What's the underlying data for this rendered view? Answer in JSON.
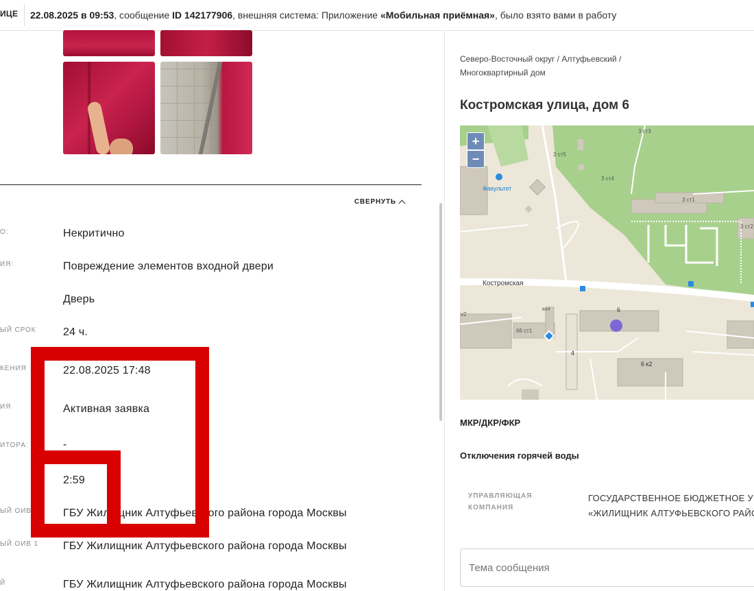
{
  "topbar": {
    "left_label": "ИЦЕ",
    "datetime": "22.08.2025 в 09:53",
    "text1": ", сообщение ",
    "msg_id": "ID 142177906",
    "text2": ", внешняя система: Приложение ",
    "system": "«Мобильная приёмная»",
    "text3": ", было взято вами в работу"
  },
  "details": {
    "collapse_label": "СВЕРНУТЬ",
    "rows": [
      {
        "label": "О:",
        "value": "Некритично"
      },
      {
        "label": "ИЯ:",
        "value": "Повреждение элементов входной двери"
      },
      {
        "label": "",
        "value": "Дверь"
      },
      {
        "label": "ЫЙ СРОК",
        "value": "24 ч."
      },
      {
        "label": "КЕНИЯ",
        "value": "22.08.2025 17:48"
      },
      {
        "label": "ИЯ",
        "value": "Активная заявка"
      },
      {
        "label": "ИТОРА:",
        "value": "-"
      },
      {
        "label": "",
        "value": "2:59"
      },
      {
        "label": "ЫЙ ОИВ",
        "value": "ГБУ Жилищник Алтуфьевского района города Москвы"
      },
      {
        "label": "ЫЙ ОИВ 1",
        "value": "ГБУ Жилищник Алтуфьевского района города Москвы"
      },
      {
        "label": "Й",
        "value": "ГБУ Жилищник Алтуфьевского района города Москвы"
      }
    ]
  },
  "right": {
    "breadcrumb": "Северо-Восточный округ / Алтуфьевский / Многоквартирный дом",
    "address": "Костромская улица, дом 6",
    "map": {
      "zoom_in": "+",
      "zoom_out": "−",
      "labels": {
        "street": "Костромская",
        "poi": "Факультет",
        "b1": "3 ст1",
        "b3": "3 ст3",
        "b4": "3 ст4",
        "b5": "3 ст5",
        "b2": "3 ст2",
        "h6": "6",
        "h66": "66 ст1",
        "h6k2": "6 к2",
        "h4": "4",
        "v2": "v2",
        "vl4": "вл4"
      }
    },
    "sections": {
      "mkr": "МКР/ДКР/ФКР",
      "hot_water": "Отключения горячей воды"
    },
    "uk": {
      "label_line1": "УПРАВЛЯЮЩАЯ",
      "label_line2": "КОМПАНИЯ",
      "value_line1": "ГОСУДАРСТВЕННОЕ БЮДЖЕТНОЕ УЧ",
      "value_line2": "«ЖИЛИЩНИК АЛТУФЬЕВСКОГО РАЙО"
    },
    "topic_placeholder": "Тема сообщения"
  },
  "colors": {
    "annotation_red": "#d80000",
    "map_marker": "#7b68d6",
    "map_green": "#a8d08d",
    "zoom_button": "#6f8bb8"
  }
}
